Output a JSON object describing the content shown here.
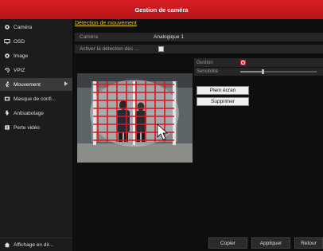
{
  "window": {
    "title": "Gestion de caméra"
  },
  "sidebar": {
    "items": [
      {
        "label": "Caméra",
        "icon": "camera-icon"
      },
      {
        "label": "OSD",
        "icon": "monitor-icon"
      },
      {
        "label": "Image",
        "icon": "image-icon"
      },
      {
        "label": "VPIZ",
        "icon": "ptz-icon"
      },
      {
        "label": "Mouvement",
        "icon": "motion-icon",
        "active": true
      },
      {
        "label": "Masque de confi...",
        "icon": "mask-icon"
      },
      {
        "label": "Antisabotage",
        "icon": "tamper-icon"
      },
      {
        "label": "Perte vidéo",
        "icon": "video-loss-icon"
      }
    ],
    "live_view_label": "Affichage en dir..."
  },
  "main": {
    "tab_label": "Détection de mouvement",
    "camera_label": "Caméra",
    "camera_value": "Analogique 1",
    "enable_label": "Activer la détection des ...",
    "enable_checked": true,
    "gestion_label": "Gestion",
    "sensitivity_label": "Sensibilité",
    "sensitivity_level": 0.3,
    "fullscreen_label": "Plein écran",
    "delete_label": "Supprimer"
  },
  "footer": {
    "copy_label": "Copier",
    "apply_label": "Appliquer",
    "back_label": "Retour"
  },
  "colors": {
    "title_red": "#d81e23",
    "accent_yellow": "#e8c620",
    "grid_red": "#e0141c"
  }
}
